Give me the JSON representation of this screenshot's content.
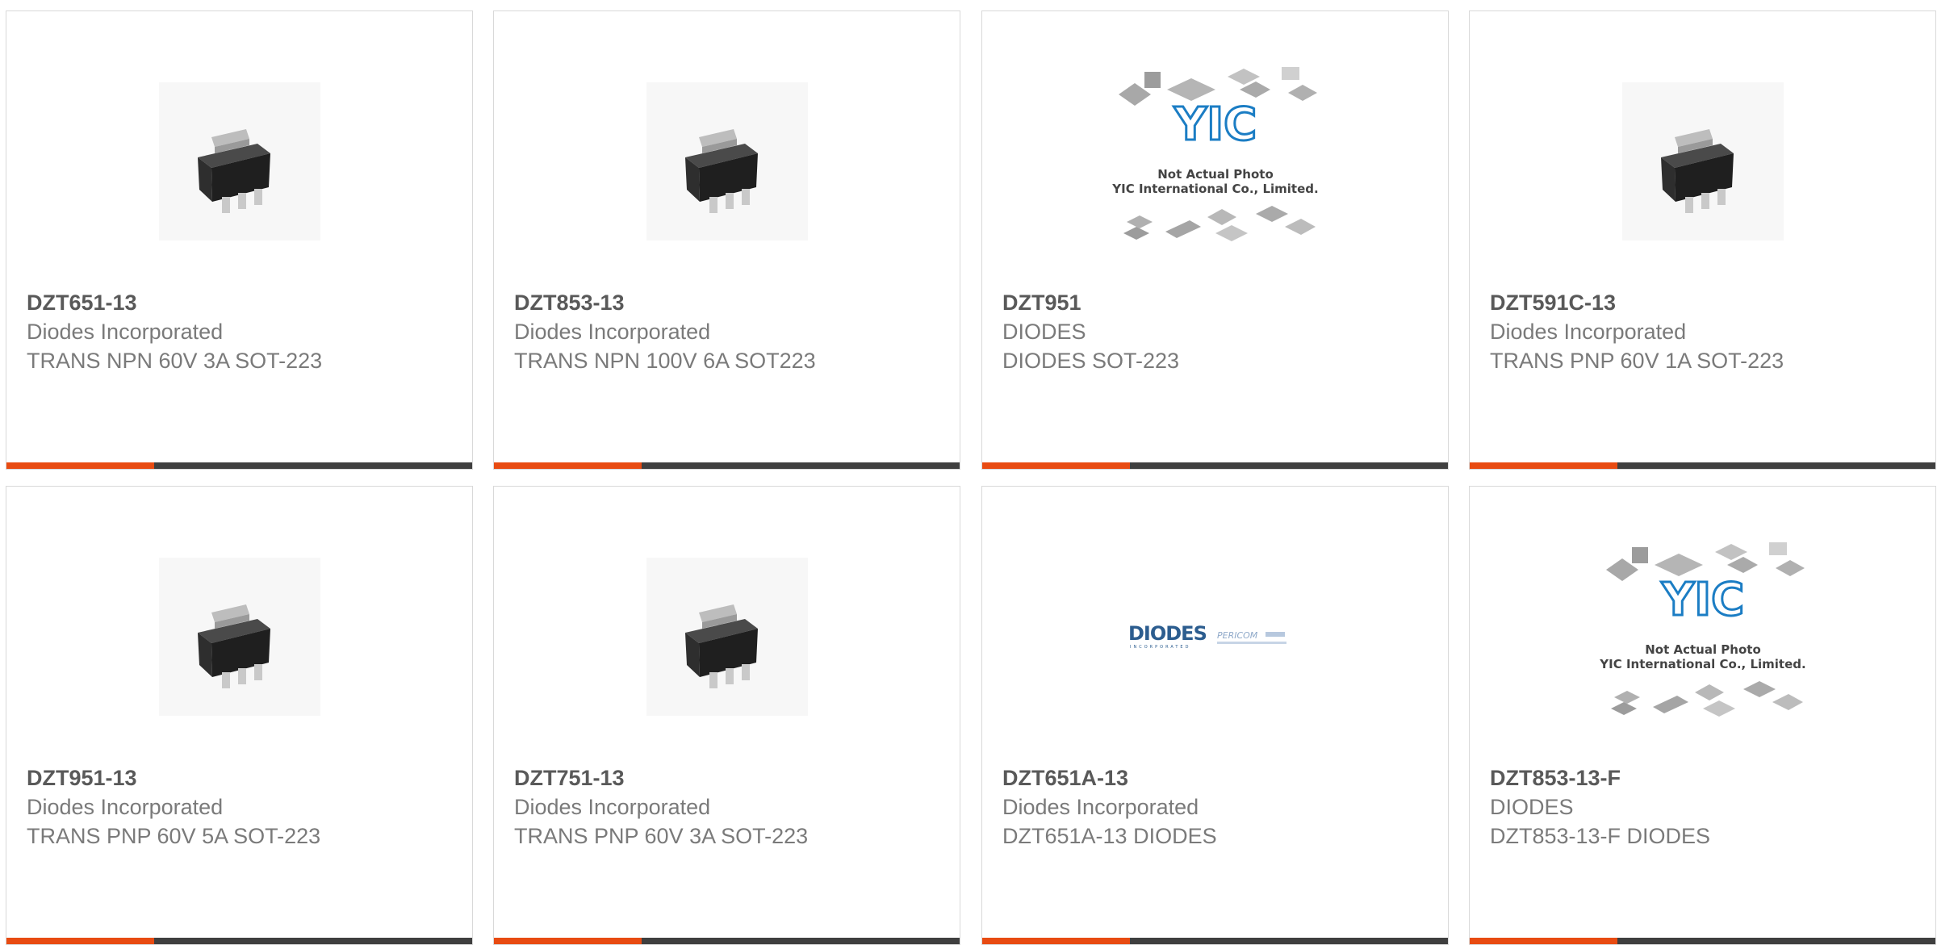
{
  "products": [
    {
      "part_number": "DZT651-13",
      "manufacturer": "Diodes Incorporated",
      "description": "TRANS NPN 60V 3A SOT-223",
      "image": "sot223-package-icon"
    },
    {
      "part_number": "DZT853-13",
      "manufacturer": "Diodes Incorporated",
      "description": "TRANS NPN 100V 6A SOT223",
      "image": "sot223-package-icon"
    },
    {
      "part_number": "DZT951",
      "manufacturer": "DIODES",
      "description": "DIODES SOT-223",
      "image": "placeholder-photo-icon"
    },
    {
      "part_number": "DZT591C-13",
      "manufacturer": "Diodes Incorporated",
      "description": "TRANS PNP 60V 1A SOT-223",
      "image": "sot223-package-icon"
    },
    {
      "part_number": "DZT951-13",
      "manufacturer": "Diodes Incorporated",
      "description": "TRANS PNP 60V 5A SOT-223",
      "image": "sot223-package-icon"
    },
    {
      "part_number": "DZT751-13",
      "manufacturer": "Diodes Incorporated",
      "description": "TRANS PNP 60V 3A SOT-223",
      "image": "sot223-package-icon"
    },
    {
      "part_number": "DZT651A-13",
      "manufacturer": "Diodes Incorporated",
      "description": "DZT651A-13 DIODES",
      "image": "diodes-pericom-logo"
    },
    {
      "part_number": "DZT853-13-F",
      "manufacturer": "DIODES",
      "description": "DZT853-13-F DIODES",
      "image": "placeholder-photo-icon"
    }
  ],
  "placeholder": {
    "brand": "YIC",
    "line1": "Not Actual Photo",
    "line2": "YIC International Co., Limited."
  },
  "logo": {
    "brand": "DIODES",
    "sub": "INCORPORATED",
    "partner": "PERICOM"
  },
  "colors": {
    "accent": "#e84b12",
    "bar": "#3f3f3f",
    "title": "#595959",
    "text": "#7a7a7a"
  }
}
